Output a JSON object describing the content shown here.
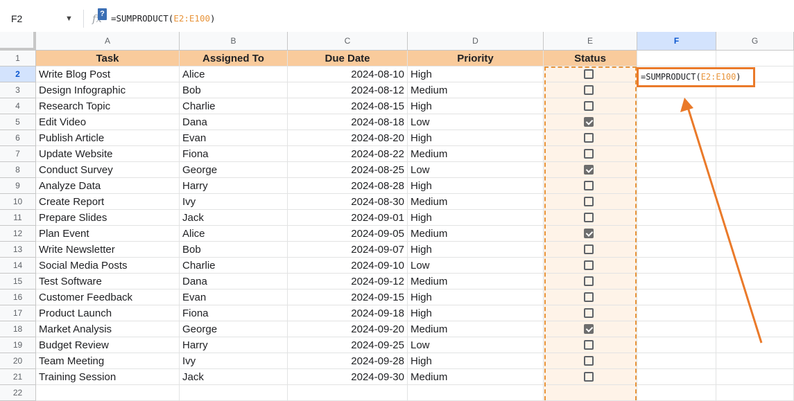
{
  "formula_bar": {
    "name_box": "F2",
    "formula_prefix": "=SUMPRODUCT(",
    "formula_ref_start": "E2",
    "formula_ref_colon": ":",
    "formula_ref_end": "E100",
    "formula_suffix": ")"
  },
  "columns": [
    "A",
    "B",
    "C",
    "D",
    "E",
    "F",
    "G"
  ],
  "active_column": "F",
  "active_row": "2",
  "headers": {
    "task": "Task",
    "assigned": "Assigned To",
    "due": "Due Date",
    "priority": "Priority",
    "status": "Status"
  },
  "rows": [
    {
      "n": "1"
    },
    {
      "n": "2",
      "task": "Write Blog Post",
      "assigned": "Alice",
      "due": "2024-08-10",
      "priority": "High",
      "checked": false
    },
    {
      "n": "3",
      "task": "Design Infographic",
      "assigned": "Bob",
      "due": "2024-08-12",
      "priority": "Medium",
      "checked": false
    },
    {
      "n": "4",
      "task": "Research Topic",
      "assigned": "Charlie",
      "due": "2024-08-15",
      "priority": "High",
      "checked": false
    },
    {
      "n": "5",
      "task": "Edit Video",
      "assigned": "Dana",
      "due": "2024-08-18",
      "priority": "Low",
      "checked": true
    },
    {
      "n": "6",
      "task": "Publish Article",
      "assigned": "Evan",
      "due": "2024-08-20",
      "priority": "High",
      "checked": false
    },
    {
      "n": "7",
      "task": "Update Website",
      "assigned": "Fiona",
      "due": "2024-08-22",
      "priority": "Medium",
      "checked": false
    },
    {
      "n": "8",
      "task": "Conduct Survey",
      "assigned": "George",
      "due": "2024-08-25",
      "priority": "Low",
      "checked": true
    },
    {
      "n": "9",
      "task": "Analyze Data",
      "assigned": "Harry",
      "due": "2024-08-28",
      "priority": "High",
      "checked": false
    },
    {
      "n": "10",
      "task": "Create Report",
      "assigned": "Ivy",
      "due": "2024-08-30",
      "priority": "Medium",
      "checked": false
    },
    {
      "n": "11",
      "task": "Prepare Slides",
      "assigned": "Jack",
      "due": "2024-09-01",
      "priority": "High",
      "checked": false
    },
    {
      "n": "12",
      "task": "Plan Event",
      "assigned": "Alice",
      "due": "2024-09-05",
      "priority": "Medium",
      "checked": true
    },
    {
      "n": "13",
      "task": "Write Newsletter",
      "assigned": "Bob",
      "due": "2024-09-07",
      "priority": "High",
      "checked": false
    },
    {
      "n": "14",
      "task": "Social Media Posts",
      "assigned": "Charlie",
      "due": "2024-09-10",
      "priority": "Low",
      "checked": false
    },
    {
      "n": "15",
      "task": "Test Software",
      "assigned": "Dana",
      "due": "2024-09-12",
      "priority": "Medium",
      "checked": false
    },
    {
      "n": "16",
      "task": "Customer Feedback",
      "assigned": "Evan",
      "due": "2024-09-15",
      "priority": "High",
      "checked": false
    },
    {
      "n": "17",
      "task": "Product Launch",
      "assigned": "Fiona",
      "due": "2024-09-18",
      "priority": "High",
      "checked": false
    },
    {
      "n": "18",
      "task": "Market Analysis",
      "assigned": "George",
      "due": "2024-09-20",
      "priority": "Medium",
      "checked": true
    },
    {
      "n": "19",
      "task": "Budget Review",
      "assigned": "Harry",
      "due": "2024-09-25",
      "priority": "Low",
      "checked": false
    },
    {
      "n": "20",
      "task": "Team Meeting",
      "assigned": "Ivy",
      "due": "2024-09-28",
      "priority": "High",
      "checked": false
    },
    {
      "n": "21",
      "task": "Training Session",
      "assigned": "Jack",
      "due": "2024-09-30",
      "priority": "Medium",
      "checked": false
    },
    {
      "n": "22"
    }
  ],
  "icons": {
    "name_box_dropdown": "chevron-down-icon",
    "function": "fx-icon",
    "help": "help-icon"
  },
  "colors": {
    "header_fill": "#f9cb9c",
    "status_fill": "#fef3e8",
    "highlight": "#ea7a2a",
    "active_header": "#d3e3fd"
  }
}
